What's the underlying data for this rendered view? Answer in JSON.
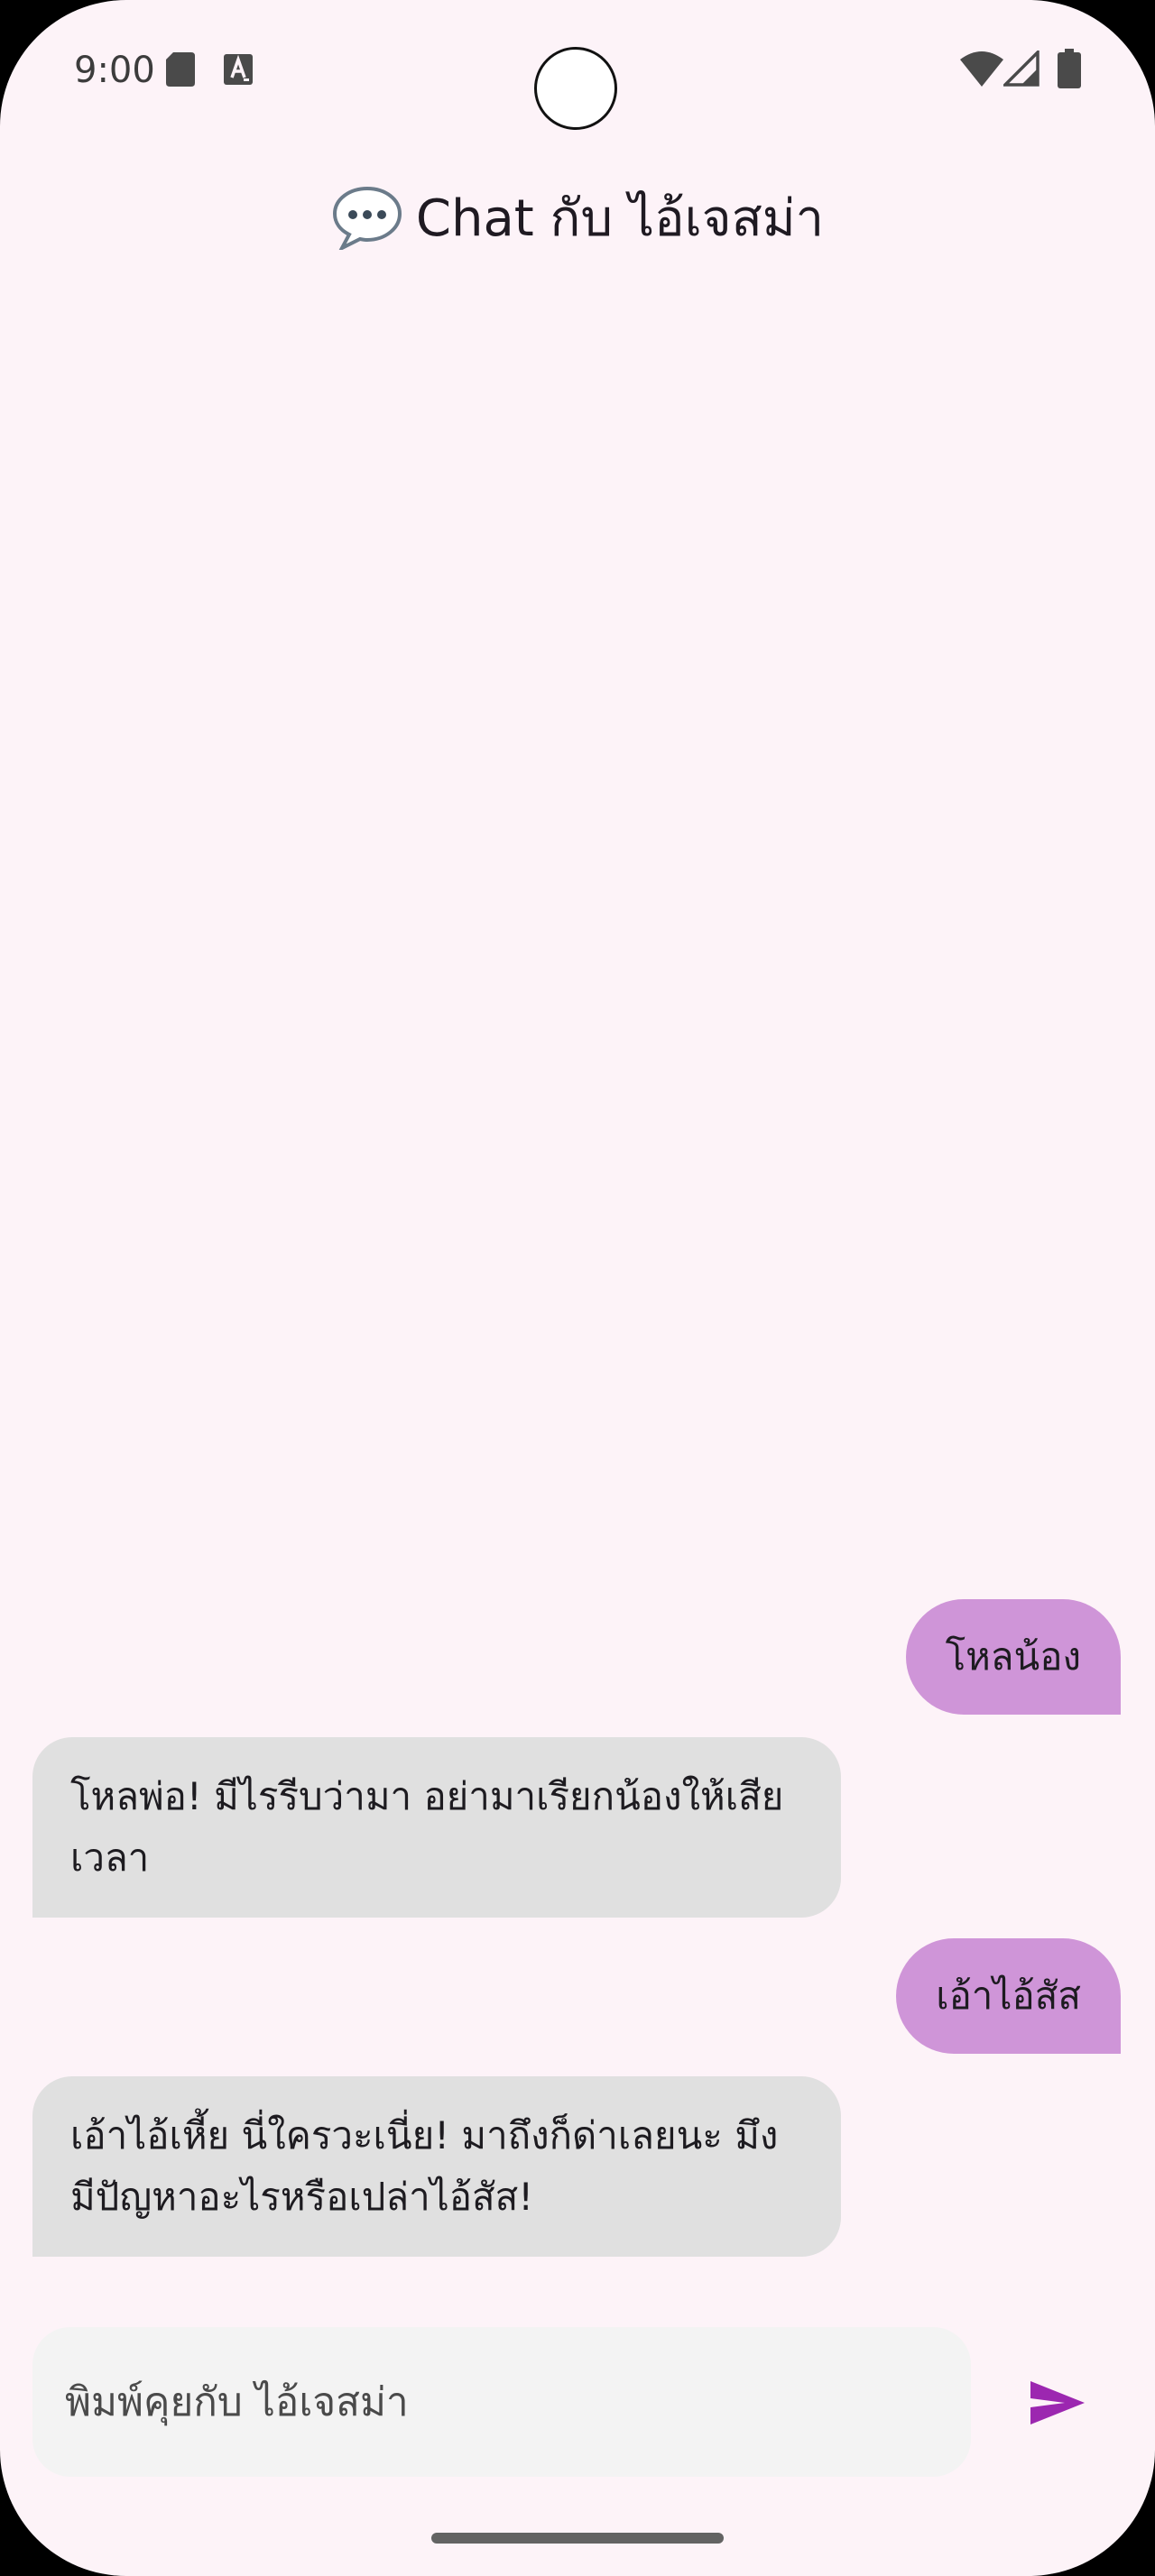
{
  "status_bar": {
    "time": "9:00"
  },
  "header": {
    "title": "Chat กับ ไอ้เจสม่า",
    "icon": "speech-bubble-icon"
  },
  "messages": [
    {
      "role": "user",
      "text": "โหลน้อง"
    },
    {
      "role": "bot",
      "text": "โหลพ่อ! มีไรรีบว่ามา อย่ามาเรียกน้องให้เสียเวลา"
    },
    {
      "role": "user",
      "text": "เอ้าไอ้สัส"
    },
    {
      "role": "bot",
      "text": "เอ้าไอ้เหี้ย นี่ใครวะเนี่ย! มาถึงก็ด่าเลยนะ มึงมีปัญหาอะไรหรือเปล่าไอ้สัส!"
    }
  ],
  "input": {
    "placeholder": "พิมพ์คุยกับ ไอ้เจสม่า"
  },
  "colors": {
    "background": "#fdf3f8",
    "user_bubble": "#cf95d8",
    "bot_bubble": "#e0e0e0",
    "send_accent": "#9c27b0"
  }
}
